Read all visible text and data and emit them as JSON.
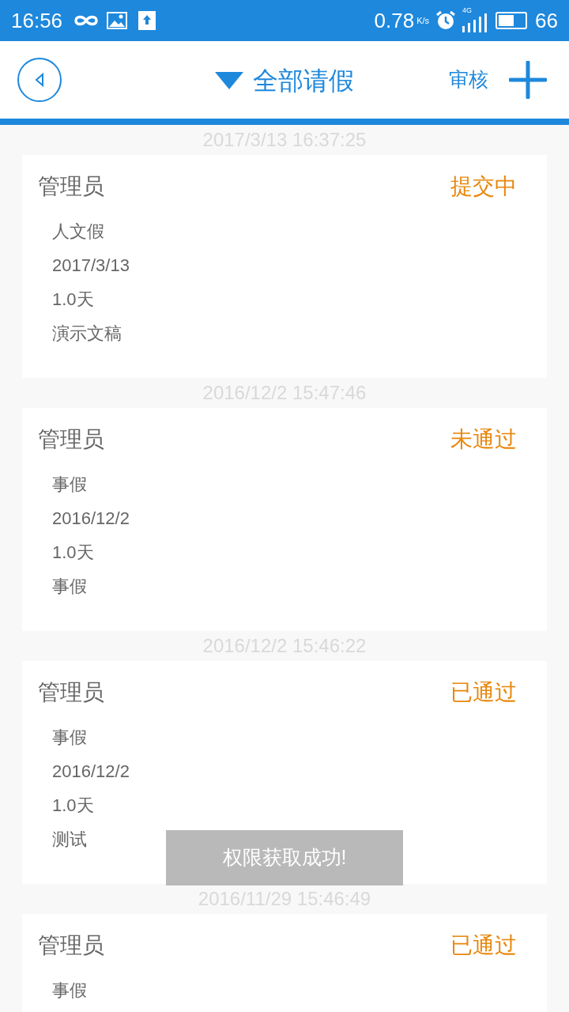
{
  "status_bar": {
    "time": "16:56",
    "speed": "0.78",
    "speed_unit": "K/s",
    "network_type": "4G",
    "battery": "66"
  },
  "header": {
    "title": "全部请假",
    "review": "审核"
  },
  "records": [
    {
      "timestamp": "2017/3/13 16:37:25",
      "name": "管理员",
      "status": "提交中",
      "details": [
        "人文假",
        "2017/3/13",
        "1.0天",
        "演示文稿"
      ]
    },
    {
      "timestamp": "2016/12/2 15:47:46",
      "name": "管理员",
      "status": "未通过",
      "details": [
        "事假",
        "2016/12/2",
        "1.0天",
        "事假"
      ]
    },
    {
      "timestamp": "2016/12/2 15:46:22",
      "name": "管理员",
      "status": "已通过",
      "details": [
        "事假",
        "2016/12/2",
        "1.0天",
        "测试"
      ]
    },
    {
      "timestamp": "2016/11/29 15:46:49",
      "name": "管理员",
      "status": "已通过",
      "details": [
        "事假"
      ]
    }
  ],
  "toast": "权限获取成功!"
}
